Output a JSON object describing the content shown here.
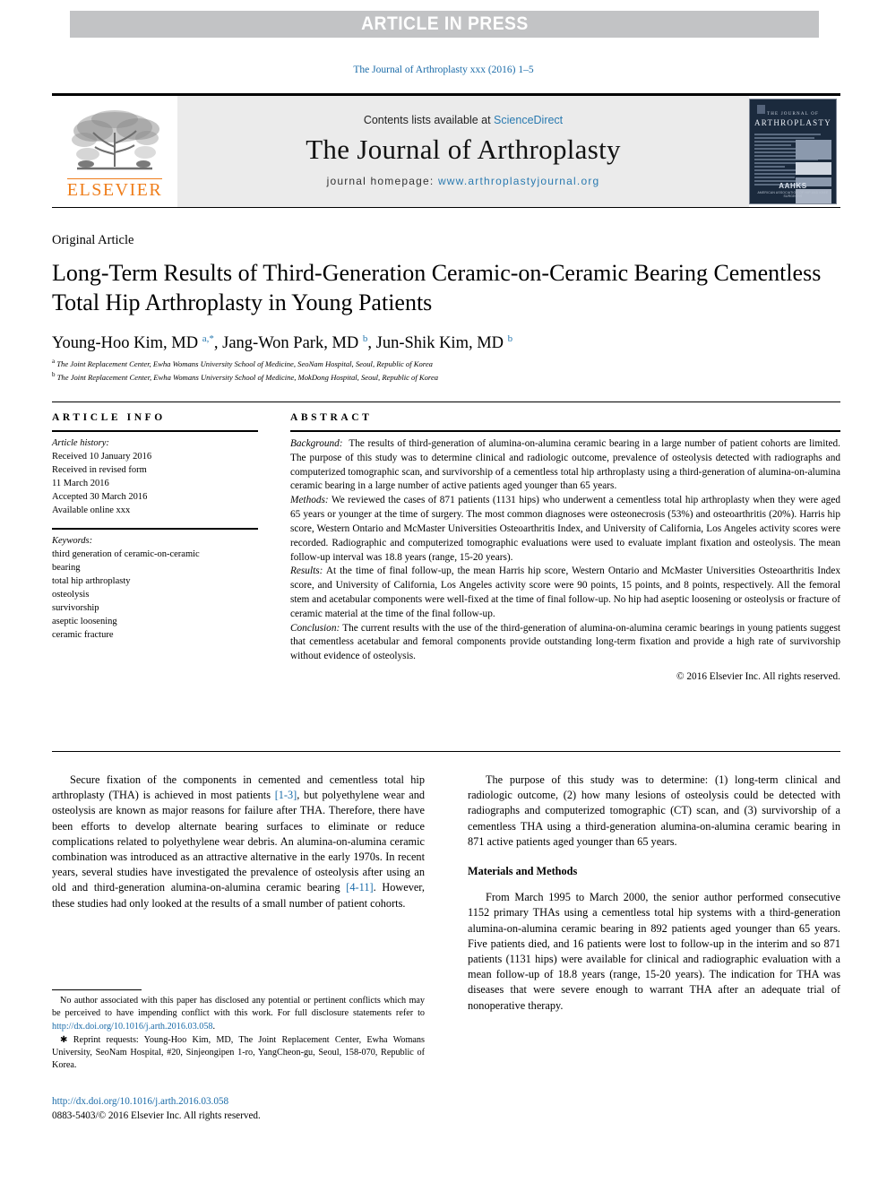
{
  "banner": {
    "text": "ARTICLE IN PRESS"
  },
  "running_head": "The Journal of Arthroplasty xxx (2016) 1–5",
  "masthead": {
    "publisher": "ELSEVIER",
    "contents_prefix": "Contents lists available at ",
    "contents_link": "ScienceDirect",
    "journal_name": "The Journal of Arthroplasty",
    "homepage_prefix": "journal homepage: ",
    "homepage_url": "www.arthroplastyjournal.org",
    "cover": {
      "line1": "THE JOURNAL OF",
      "line2": "ARTHROPLASTY",
      "society": "AAHKS",
      "society_sub": "AMERICAN ASSOCIATION OF HIP AND KNEE SURGEONS"
    }
  },
  "article": {
    "type": "Original Article",
    "title": "Long-Term Results of Third-Generation Ceramic-on-Ceramic Bearing Cementless Total Hip Arthroplasty in Young Patients",
    "authors_html": "Young-Hoo Kim, MD <sup>a,&#42;</sup>, Jang-Won Park, MD <sup>b</sup>, Jun-Shik Kim, MD <sup>b</sup>",
    "affiliation_a": "The Joint Replacement Center, Ewha Womans University School of Medicine, SeoNam Hospital, Seoul, Republic of Korea",
    "affiliation_b": "The Joint Replacement Center, Ewha Womans University School of Medicine, MokDong Hospital, Seoul, Republic of Korea"
  },
  "info": {
    "heading": "ARTICLE INFO",
    "history_label": "Article history:",
    "history": [
      "Received 10 January 2016",
      "Received in revised form",
      "11 March 2016",
      "Accepted 30 March 2016",
      "Available online xxx"
    ],
    "keywords_label": "Keywords:",
    "keywords": [
      "third generation of ceramic-on-ceramic",
      "bearing",
      "total hip arthroplasty",
      "osteolysis",
      "survivorship",
      "aseptic loosening",
      "ceramic fracture"
    ]
  },
  "abstract": {
    "heading": "ABSTRACT",
    "background_label": "Background:",
    "background": "The results of third-generation of alumina-on-alumina ceramic bearing in a large number of patient cohorts are limited. The purpose of this study was to determine clinical and radiologic outcome, prevalence of osteolysis detected with radiographs and computerized tomographic scan, and survivorship of a cementless total hip arthroplasty using a third-generation of alumina-on-alumina ceramic bearing in a large number of active patients aged younger than 65 years.",
    "methods_label": "Methods:",
    "methods": "We reviewed the cases of 871 patients (1131 hips) who underwent a cementless total hip arthroplasty when they were aged 65 years or younger at the time of surgery. The most common diagnoses were osteonecrosis (53%) and osteoarthritis (20%). Harris hip score, Western Ontario and McMaster Universities Osteoarthritis Index, and University of California, Los Angeles activity scores were recorded. Radiographic and computerized tomographic evaluations were used to evaluate implant fixation and osteolysis. The mean follow-up interval was 18.8 years (range, 15-20 years).",
    "results_label": "Results:",
    "results": "At the time of final follow-up, the mean Harris hip score, Western Ontario and McMaster Universities Osteoarthritis Index score, and University of California, Los Angeles activity score were 90 points, 15 points, and 8 points, respectively. All the femoral stem and acetabular components were well-fixed at the time of final follow-up. No hip had aseptic loosening or osteolysis or fracture of ceramic material at the time of the final follow-up.",
    "conclusion_label": "Conclusion:",
    "conclusion": "The current results with the use of the third-generation of alumina-on-alumina ceramic bearings in young patients suggest that cementless acetabular and femoral components provide outstanding long-term fixation and provide a high rate of survivorship without evidence of osteolysis.",
    "copyright": "© 2016 Elsevier Inc. All rights reserved."
  },
  "body": {
    "left_para_1_pre": "Secure fixation of the components in cemented and cementless total hip arthroplasty (THA) is achieved in most patients ",
    "left_para_1_ref": "[1-3]",
    "left_para_1_mid": ", but polyethylene wear and osteolysis are known as major reasons for failure after THA. Therefore, there have been efforts to develop alternate bearing surfaces to eliminate or reduce complications related to polyethylene wear debris. An alumina-on-alumina ceramic combination was introduced as an attractive alternative in the early 1970s. In recent years, several studies have investigated the prevalence of osteolysis after using an old and third-generation alumina-on-alumina ceramic bearing ",
    "left_para_1_ref2": "[4-11]",
    "left_para_1_end": ". However, these studies had only looked at the results of a small number of patient cohorts.",
    "right_para_1": "The purpose of this study was to determine: (1) long-term clinical and radiologic outcome, (2) how many lesions of osteolysis could be detected with radiographs and computerized tomographic (CT) scan, and (3) survivorship of a cementless THA using a third-generation alumina-on-alumina ceramic bearing in 871 active patients aged younger than 65 years.",
    "methods_heading": "Materials and Methods",
    "right_para_2": "From March 1995 to March 2000, the senior author performed consecutive 1152 primary THAs using a cementless total hip systems with a third-generation alumina-on-alumina ceramic bearing in 892 patients aged younger than 65 years. Five patients died, and 16 patients were lost to follow-up in the interim and so 871 patients (1131 hips) were available for clinical and radiographic evaluation with a mean follow-up of 18.8 years (range, 15-20 years). The indication for THA was diseases that were severe enough to warrant THA after an adequate trial of nonoperative therapy."
  },
  "footnotes": {
    "disclosure_pre": "No author associated with this paper has disclosed any potential or pertinent conflicts which may be perceived to have impending conflict with this work. For full disclosure statements refer to ",
    "disclosure_link": "http://dx.doi.org/10.1016/j.arth.2016.03.058",
    "disclosure_post": ".",
    "reprint": "✱ Reprint requests: Young-Hoo Kim, MD, The Joint Replacement Center, Ewha Womans University, SeoNam Hospital, #20, Sinjeongipen 1-ro, YangCheon-gu, Seoul, 158-070, Republic of Korea."
  },
  "doi_block": {
    "doi": "http://dx.doi.org/10.1016/j.arth.2016.03.058",
    "issn": "0883-5403/© 2016 Elsevier Inc. All rights reserved."
  }
}
